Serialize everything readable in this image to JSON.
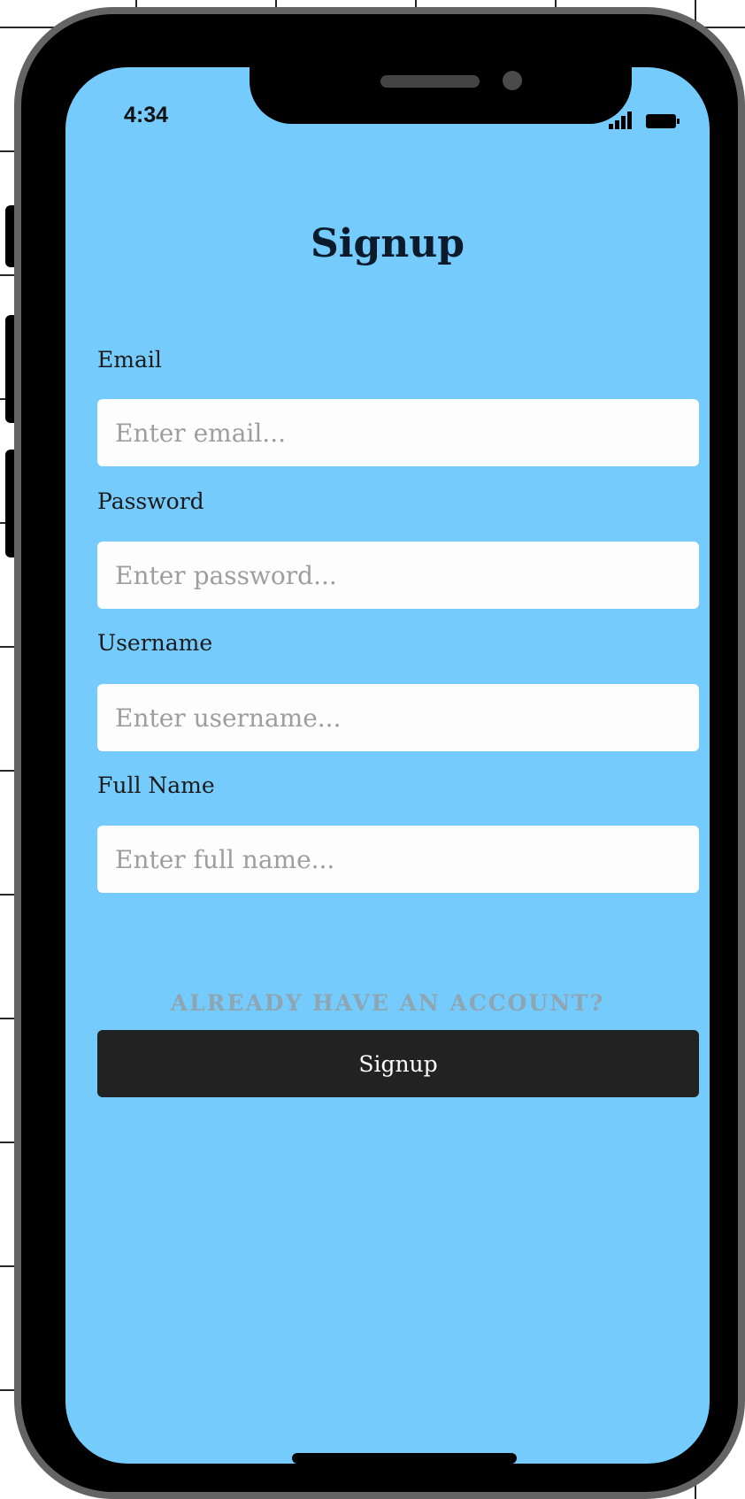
{
  "status_bar": {
    "time": "4:34"
  },
  "form": {
    "title": "Signup",
    "email": {
      "label": "Email",
      "placeholder": "Enter email..."
    },
    "password": {
      "label": "Password",
      "placeholder": "Enter password..."
    },
    "username": {
      "label": "Username",
      "placeholder": "Enter username..."
    },
    "full_name": {
      "label": "Full Name",
      "placeholder": "Enter full name..."
    },
    "account_link": "ALREADY HAVE AN ACCOUNT?",
    "submit_label": "Signup"
  },
  "colors": {
    "screen_background": "#75cbfb",
    "button_background": "#222222",
    "frame_border": "#646464"
  },
  "icons": [
    "signal-icon",
    "battery-icon"
  ]
}
